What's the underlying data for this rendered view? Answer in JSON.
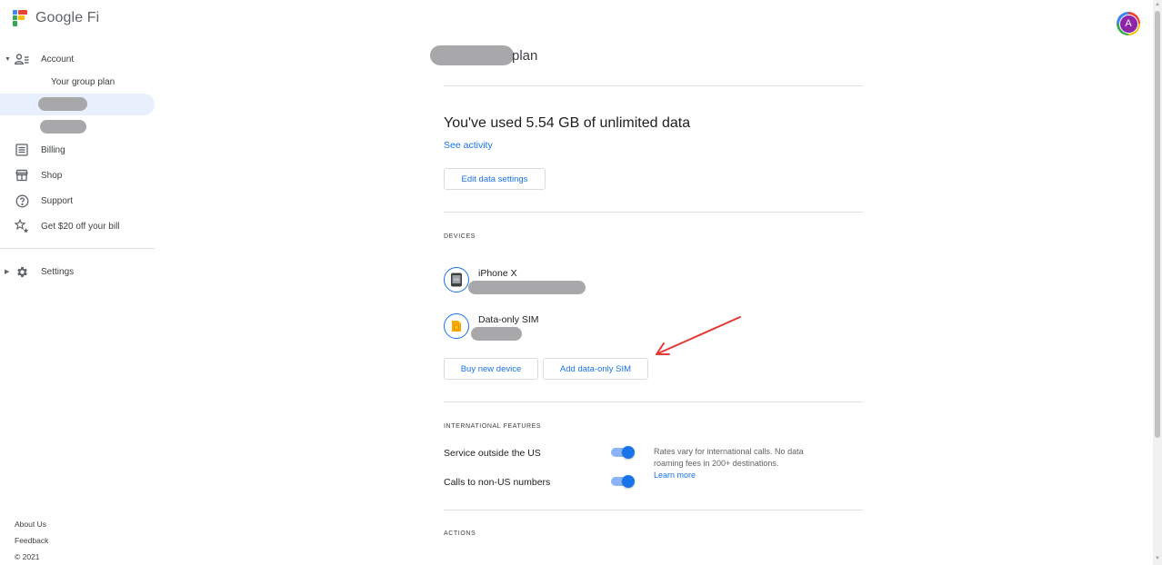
{
  "header": {
    "brand": "Google Fi",
    "avatar_initial": "A"
  },
  "sidebar": {
    "account_label": "Account",
    "group_plan_label": "Your group plan",
    "billing_label": "Billing",
    "shop_label": "Shop",
    "support_label": "Support",
    "referral_label": "Get $20 off your bill",
    "settings_label": "Settings"
  },
  "footer": {
    "about": "About Us",
    "feedback": "Feedback",
    "copyright": "© 2021"
  },
  "main": {
    "plan_title_suffix": "plan",
    "usage_title": "You've used 5.54 GB of unlimited data",
    "see_activity": "See activity",
    "edit_data_settings": "Edit data settings",
    "devices_heading": "DEVICES",
    "devices": [
      {
        "name": "iPhone X",
        "icon": "phone-icon"
      },
      {
        "name": "Data-only SIM",
        "icon": "sim-card-icon"
      }
    ],
    "buy_new_device": "Buy new device",
    "add_data_only_sim": "Add data-only SIM",
    "intl_heading": "INTERNATIONAL FEATURES",
    "features": [
      {
        "label": "Service outside the US",
        "enabled": true
      },
      {
        "label": "Calls to non-US numbers",
        "enabled": true
      }
    ],
    "intl_note": "Rates vary for international calls. No data roaming fees in 200+ destinations.",
    "learn_more": "Learn more",
    "actions_heading": "ACTIONS"
  },
  "colors": {
    "accent": "#1a73e8",
    "selected_bg": "#e8f0fe",
    "annotation_arrow": "#e53935"
  }
}
